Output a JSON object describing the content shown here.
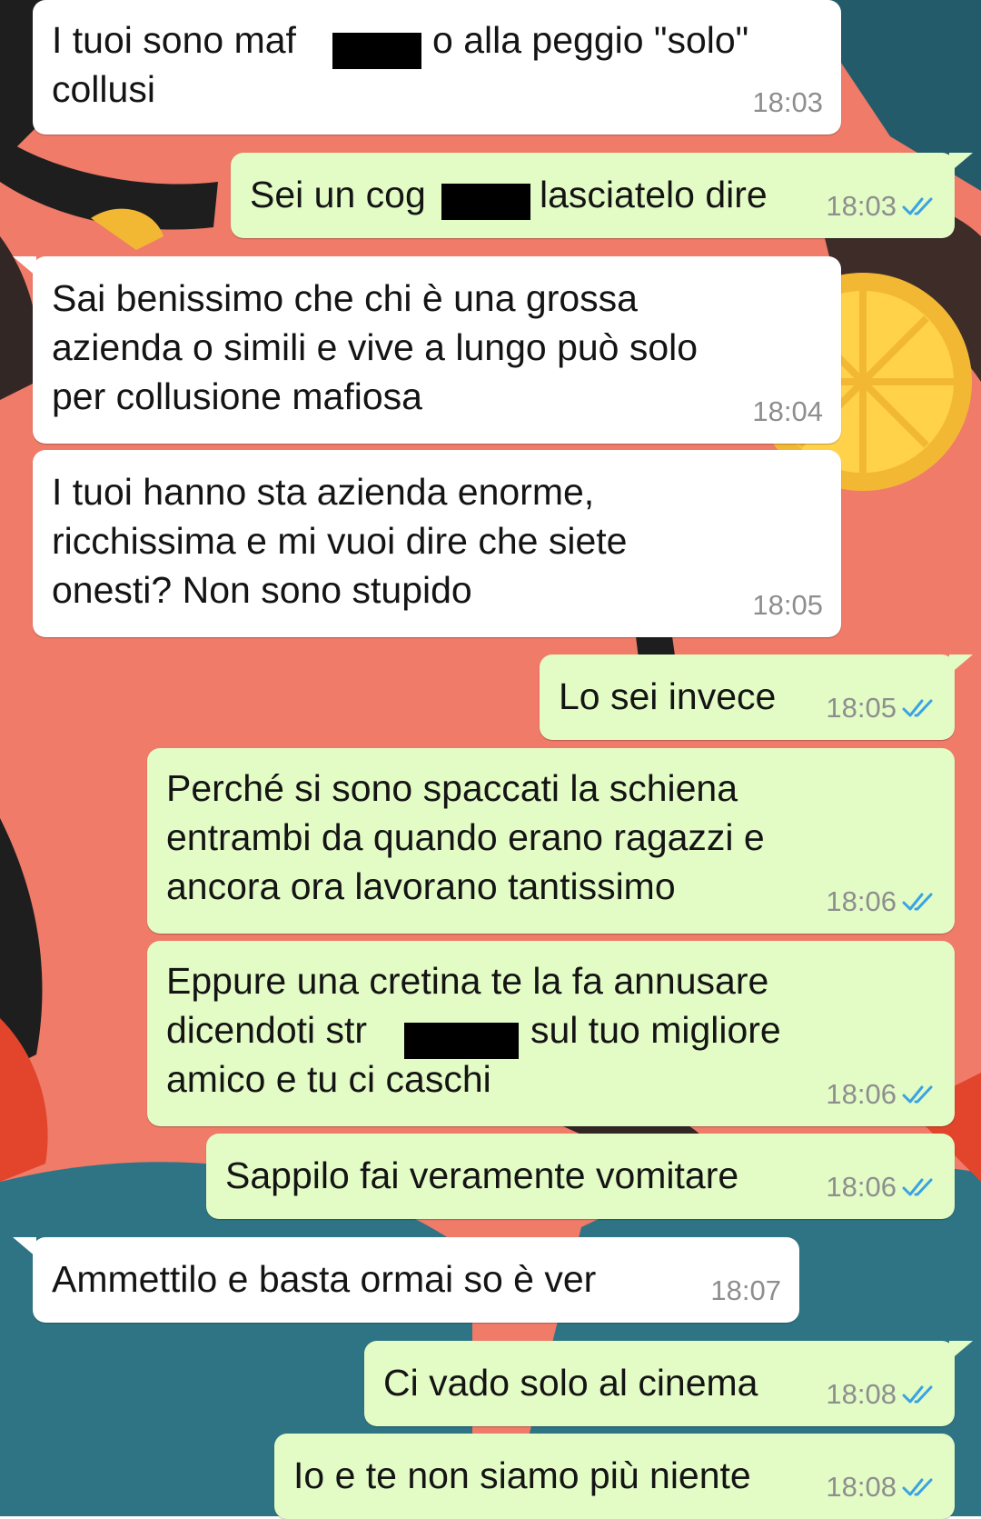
{
  "theme": {
    "incoming_bg": "#ffffff",
    "outgoing_bg": "#e3fcc6",
    "time_color": "#8e8e8e",
    "read_check_color": "#3aa3e3",
    "wallpaper_color": "#ef7b68"
  },
  "messages": [
    {
      "direction": "incoming",
      "lines": [
        "I tuoi sono maf",
        "collusi"
      ],
      "line_suffix": "o alla peggio \"solo\"",
      "time": "18:03"
    },
    {
      "direction": "outgoing",
      "text_before": "Sei un cog",
      "text_after": "lasciatelo dire",
      "time": "18:03",
      "status_icon": "double-check-read-icon"
    },
    {
      "direction": "incoming",
      "lines": [
        "Sai benissimo che chi è una grossa",
        "azienda o simili e vive a lungo può solo",
        "per collusione mafiosa"
      ],
      "time": "18:04"
    },
    {
      "direction": "incoming",
      "lines": [
        "I tuoi hanno sta azienda enorme,",
        "ricchissima e mi vuoi dire che siete",
        "onesti? Non sono stupido"
      ],
      "time": "18:05"
    },
    {
      "direction": "outgoing",
      "lines": [
        "Lo sei invece"
      ],
      "time": "18:05",
      "status_icon": "double-check-read-icon"
    },
    {
      "direction": "outgoing",
      "lines": [
        "Perché si sono spaccati la schiena",
        "entrambi da quando erano ragazzi e",
        "ancora ora lavorano tantissimo"
      ],
      "time": "18:06",
      "status_icon": "double-check-read-icon"
    },
    {
      "direction": "outgoing",
      "lines": [
        "Eppure una cretina te la fa annusare",
        "dicendoti str",
        "amico e tu ci caschi"
      ],
      "line_suffix": "sul tuo migliore",
      "time": "18:06",
      "status_icon": "double-check-read-icon"
    },
    {
      "direction": "outgoing",
      "lines": [
        "Sappilo fai veramente vomitare"
      ],
      "time": "18:06",
      "status_icon": "double-check-read-icon"
    },
    {
      "direction": "incoming",
      "lines": [
        "Ammettilo e basta ormai so è ver"
      ],
      "time": "18:07"
    },
    {
      "direction": "outgoing",
      "lines": [
        "Ci vado solo al cinema"
      ],
      "time": "18:08",
      "status_icon": "double-check-read-icon"
    },
    {
      "direction": "outgoing",
      "lines": [
        "Io e te non siamo più niente"
      ],
      "time": "18:08",
      "status_icon": "double-check-read-icon"
    }
  ]
}
